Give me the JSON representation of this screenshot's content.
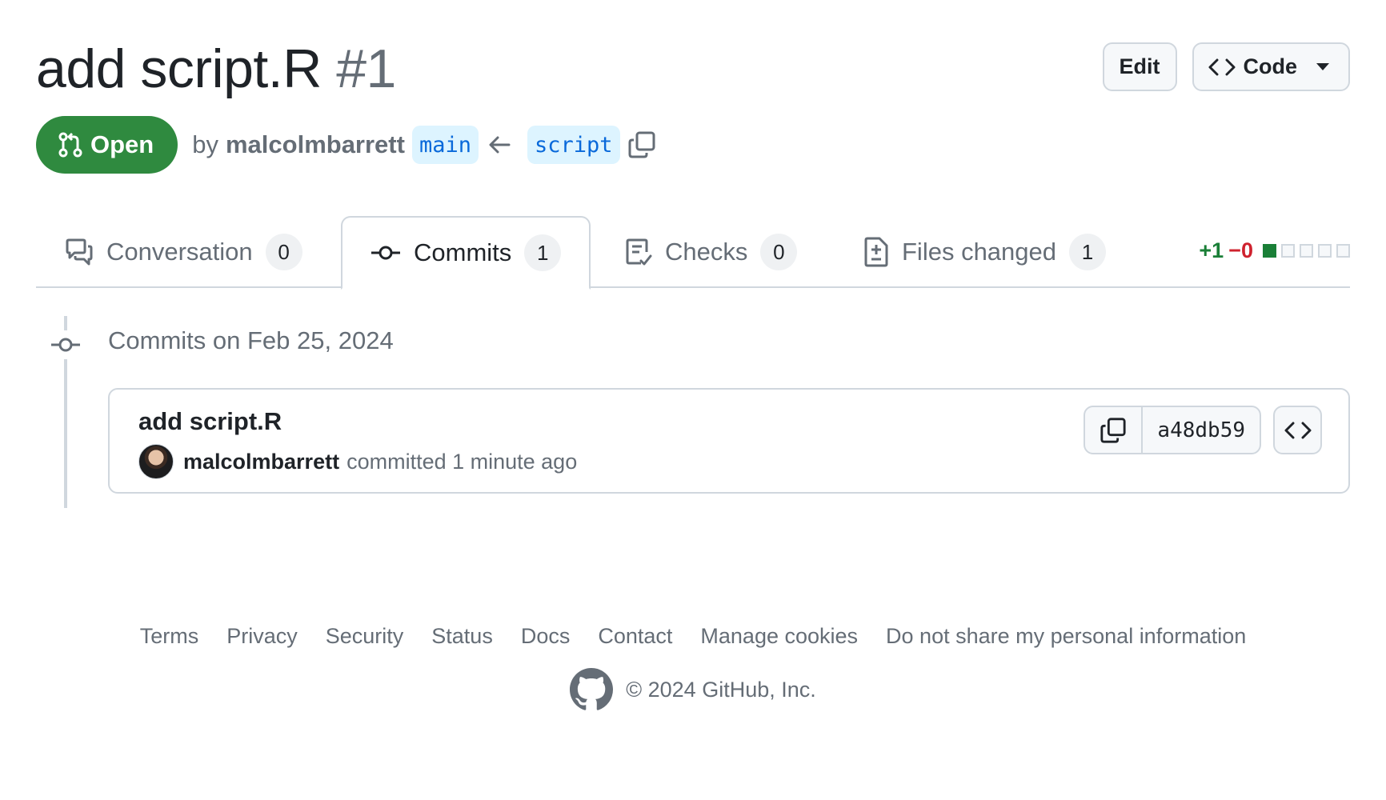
{
  "pr": {
    "title": "add script.R",
    "number": "#1",
    "state": "Open",
    "by_label": "by",
    "author": "malcolmbarrett",
    "base_branch": "main",
    "head_branch": "script"
  },
  "actions": {
    "edit_label": "Edit",
    "code_label": "Code"
  },
  "tabs": [
    {
      "label": "Conversation",
      "count": "0",
      "icon": "comment-discussion-icon"
    },
    {
      "label": "Commits",
      "count": "1",
      "icon": "git-commit-icon",
      "active": true
    },
    {
      "label": "Checks",
      "count": "0",
      "icon": "checklist-icon"
    },
    {
      "label": "Files changed",
      "count": "1",
      "icon": "file-diff-icon"
    }
  ],
  "diffstat": {
    "additions": "+1",
    "deletions": "−0",
    "blocks": [
      "added",
      "neutral",
      "neutral",
      "neutral",
      "neutral"
    ]
  },
  "timeline": {
    "group_title": "Commits on Feb 25, 2024",
    "commits": [
      {
        "message": "add script.R",
        "author": "malcolmbarrett",
        "action": "committed 1 minute ago",
        "sha": "a48db59"
      }
    ]
  },
  "footer": {
    "links": [
      "Terms",
      "Privacy",
      "Security",
      "Status",
      "Docs",
      "Contact",
      "Manage cookies",
      "Do not share my personal information"
    ],
    "copyright": "© 2024 GitHub, Inc."
  },
  "colors": {
    "open_state": "#2f8a3f",
    "branch_bg": "#ddf4ff",
    "branch_text": "#0969da",
    "additions": "#1a7f37",
    "deletions": "#cf222e",
    "muted_text": "#656d76",
    "border": "#d0d7de"
  }
}
